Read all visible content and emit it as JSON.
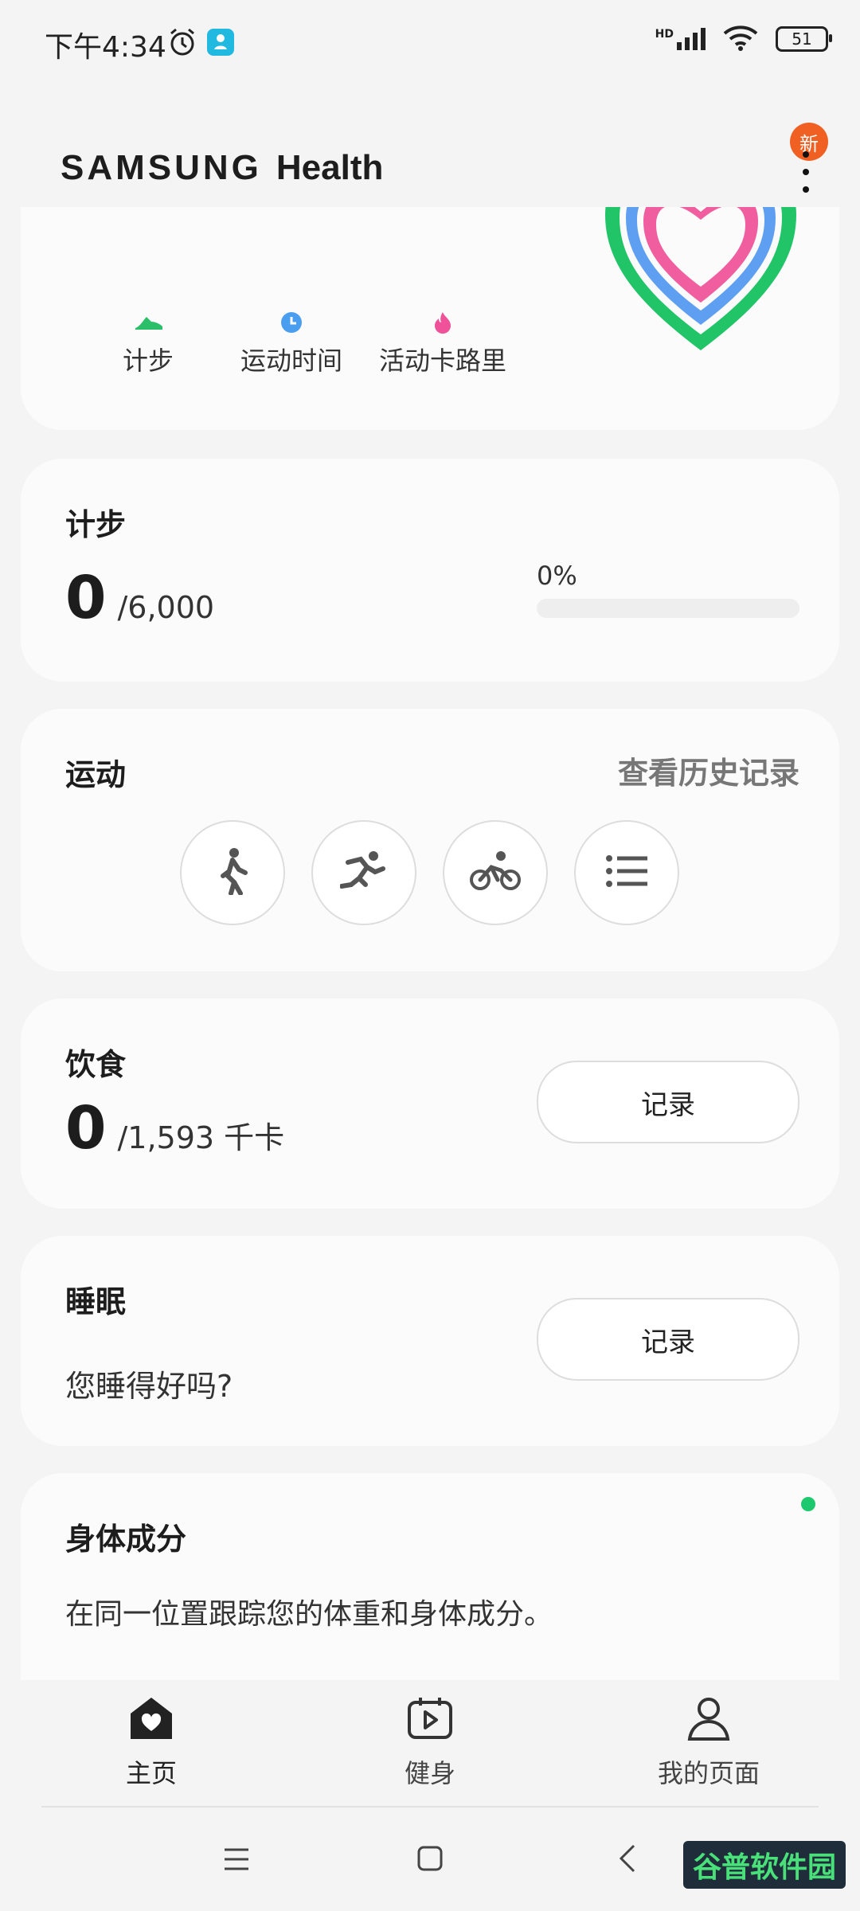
{
  "status_bar": {
    "time": "下午4:34",
    "signal_label": "HD",
    "battery": "51"
  },
  "header": {
    "brand_samsung": "SAMSUNG",
    "brand_health": "Health",
    "new_badge": "新"
  },
  "summary": {
    "legend": [
      {
        "label": "计步",
        "icon": "shoe-icon",
        "color": "#2bbf6a"
      },
      {
        "label": "运动时间",
        "icon": "clock-icon",
        "color": "#4a9ef0"
      },
      {
        "label": "活动卡路里",
        "icon": "flame-icon",
        "color": "#f0529a"
      }
    ]
  },
  "steps": {
    "title": "计步",
    "value": "0",
    "goal": "/6,000",
    "percent": "0%",
    "progress_fraction": 0
  },
  "exercise": {
    "title": "运动",
    "history_link": "查看历史记录",
    "activities": [
      "walking-icon",
      "running-icon",
      "cycling-icon",
      "list-icon"
    ]
  },
  "food": {
    "title": "饮食",
    "value": "0",
    "goal": "/1,593 千卡",
    "button": "记录"
  },
  "sleep": {
    "title": "睡眠",
    "prompt": "您睡得好吗?",
    "button": "记录"
  },
  "body_composition": {
    "title": "身体成分",
    "description": "在同一位置跟踪您的体重和身体成分。"
  },
  "bottom_nav": {
    "items": [
      {
        "label": "主页",
        "icon": "home-heart-icon"
      },
      {
        "label": "健身",
        "icon": "fitness-calendar-icon"
      },
      {
        "label": "我的页面",
        "icon": "person-icon"
      }
    ]
  },
  "watermark": "谷普软件园",
  "colors": {
    "steps_green": "#2bbf6a",
    "time_blue": "#4a9ef0",
    "calorie_pink": "#f0529a",
    "badge_orange": "#f06022",
    "dot_green": "#1ec86e"
  }
}
